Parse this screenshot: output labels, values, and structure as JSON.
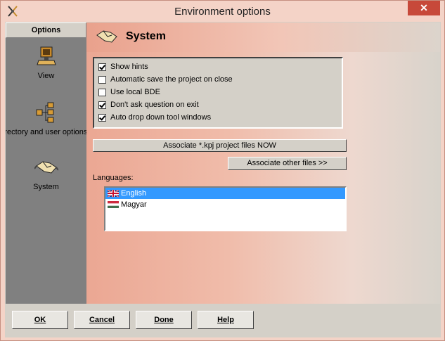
{
  "window": {
    "title": "Environment options",
    "close_glyph": "✕"
  },
  "sidebar": {
    "header": "Options",
    "items": [
      {
        "label": "View",
        "icon": "monitor-icon"
      },
      {
        "label": "Directory and user options",
        "icon": "directory-tree-icon"
      },
      {
        "label": "System",
        "icon": "handshake-icon"
      }
    ]
  },
  "content": {
    "title": "System",
    "options": [
      {
        "label": "Show hints",
        "checked": true
      },
      {
        "label": "Automatic save the project on close",
        "checked": false
      },
      {
        "label": "Use local BDE",
        "checked": false
      },
      {
        "label": "Don't ask question on exit",
        "checked": true
      },
      {
        "label": "Auto drop down tool windows",
        "checked": true
      }
    ],
    "associate_now_label": "Associate *.kpj project files NOW",
    "associate_other_label": "Associate other files >>",
    "languages_label": "Languages:",
    "languages": [
      {
        "name": "English",
        "flag": "uk-flag-icon",
        "selected": true
      },
      {
        "name": "Magyar",
        "flag": "hungary-flag-icon",
        "selected": false
      }
    ]
  },
  "footer": {
    "ok": "OK",
    "cancel": "Cancel",
    "done": "Done",
    "help": "Help"
  },
  "colors": {
    "selection": "#3399ff",
    "close": "#c7493a"
  }
}
